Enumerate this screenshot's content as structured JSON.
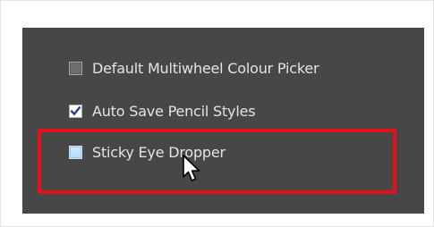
{
  "options": [
    {
      "label": "Default Multiwheel Colour Picker",
      "checked": false
    },
    {
      "label": "Auto Save Pencil Styles",
      "checked": true
    },
    {
      "label": "Sticky Eye Dropper",
      "checked": false,
      "hovered": true
    }
  ],
  "icons": {
    "check": "check-icon",
    "cursor": "mouse-pointer-icon"
  },
  "colors": {
    "panel_background": "#474747",
    "highlight_border": "#e6101c",
    "label_text": "#e4e4e4"
  }
}
